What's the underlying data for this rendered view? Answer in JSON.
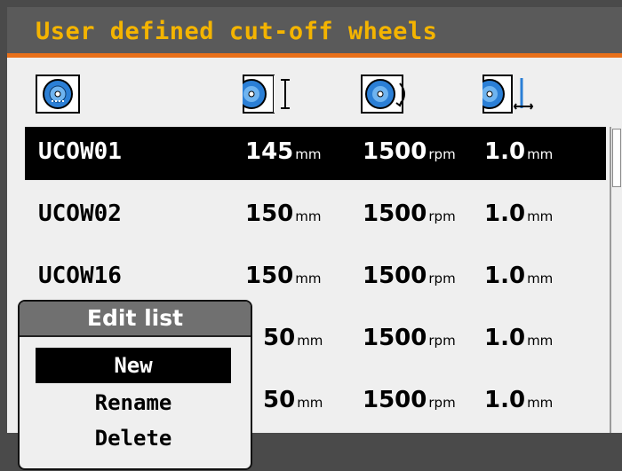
{
  "window": {
    "title": "User defined cut-off wheels"
  },
  "columns": [
    {
      "icon": "wheel-icon"
    },
    {
      "icon": "wheel-diameter-icon"
    },
    {
      "icon": "wheel-speed-icon"
    },
    {
      "icon": "wheel-thickness-icon"
    }
  ],
  "rows": [
    {
      "name": "UCOW01",
      "diameter": "145",
      "diameter_unit": "mm",
      "speed": "1500",
      "speed_unit": "rpm",
      "thickness": "1.0",
      "thickness_unit": "mm",
      "selected": true
    },
    {
      "name": "UCOW02",
      "diameter": "150",
      "diameter_unit": "mm",
      "speed": "1500",
      "speed_unit": "rpm",
      "thickness": "1.0",
      "thickness_unit": "mm",
      "selected": false
    },
    {
      "name": "UCOW16",
      "diameter": "150",
      "diameter_unit": "mm",
      "speed": "1500",
      "speed_unit": "rpm",
      "thickness": "1.0",
      "thickness_unit": "mm",
      "selected": false
    },
    {
      "name": "",
      "diameter": "50",
      "diameter_unit": "mm",
      "speed": "1500",
      "speed_unit": "rpm",
      "thickness": "1.0",
      "thickness_unit": "mm",
      "selected": false
    },
    {
      "name": "",
      "diameter": "50",
      "diameter_unit": "mm",
      "speed": "1500",
      "speed_unit": "rpm",
      "thickness": "1.0",
      "thickness_unit": "mm",
      "selected": false
    }
  ],
  "popup": {
    "title": "Edit list",
    "items": [
      {
        "label": "New",
        "selected": true
      },
      {
        "label": "Rename",
        "selected": false
      },
      {
        "label": "Delete",
        "selected": false
      }
    ]
  },
  "colors": {
    "title_text": "#f4b400",
    "accent": "#e8701a",
    "wheel_blue": "#2b7fd6"
  }
}
